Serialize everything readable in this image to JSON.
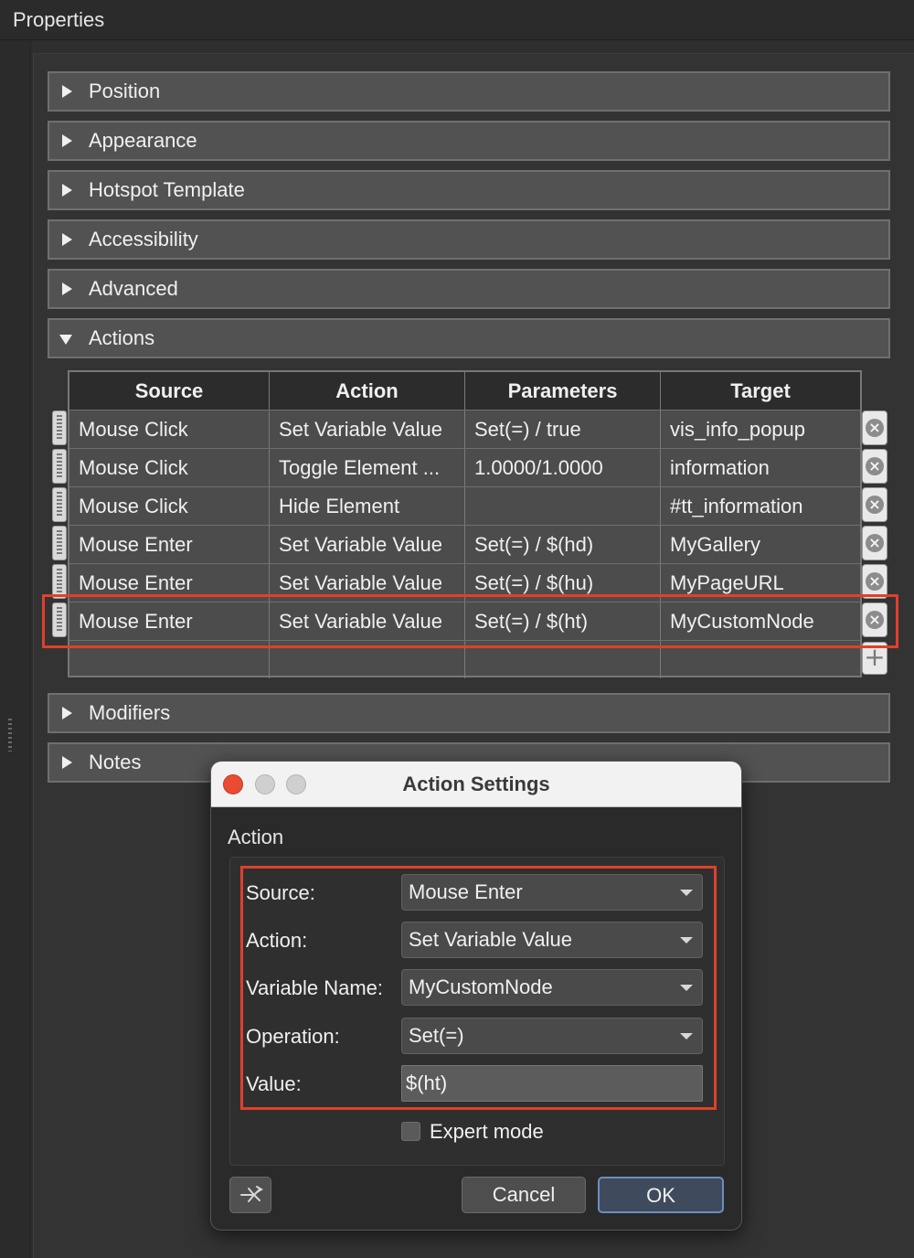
{
  "panel": {
    "title": "Properties"
  },
  "sections": {
    "position": "Position",
    "appearance": "Appearance",
    "hotspot_template": "Hotspot Template",
    "accessibility": "Accessibility",
    "advanced": "Advanced",
    "actions": "Actions",
    "modifiers": "Modifiers",
    "notes": "Notes"
  },
  "actions_table": {
    "columns": [
      "Source",
      "Action",
      "Parameters",
      "Target"
    ],
    "rows": [
      [
        "Mouse Click",
        "Set Variable Value",
        "Set(=) / true",
        "vis_info_popup"
      ],
      [
        "Mouse Click",
        "Toggle Element ...",
        "1.0000/1.0000",
        "information"
      ],
      [
        "Mouse Click",
        "Hide Element",
        "",
        "#tt_information"
      ],
      [
        "Mouse Enter",
        "Set Variable Value",
        "Set(=) / $(hd)",
        "MyGallery"
      ],
      [
        "Mouse Enter",
        "Set Variable Value",
        "Set(=) / $(hu)",
        "MyPageURL"
      ],
      [
        "Mouse Enter",
        "Set Variable Value",
        "Set(=) / $(ht)",
        "MyCustomNode"
      ]
    ],
    "delete_glyph": "×",
    "add_glyph": "+"
  },
  "dialog": {
    "title": "Action Settings",
    "group_label": "Action",
    "fields": {
      "source_label": "Source:",
      "source_value": "Mouse Enter",
      "action_label": "Action:",
      "action_value": "Set Variable Value",
      "variable_label": "Variable Name:",
      "variable_value": "MyCustomNode",
      "operation_label": "Operation:",
      "operation_value": "Set(=)",
      "value_label": "Value:",
      "value_value": "$(ht)"
    },
    "expert_mode_label": "Expert mode",
    "expert_mode_checked": false,
    "cancel_label": "Cancel",
    "ok_label": "OK"
  },
  "colors": {
    "highlight": "#e0402b",
    "close_button": "#ea4b33",
    "ok_border": "#6b8ec2"
  }
}
